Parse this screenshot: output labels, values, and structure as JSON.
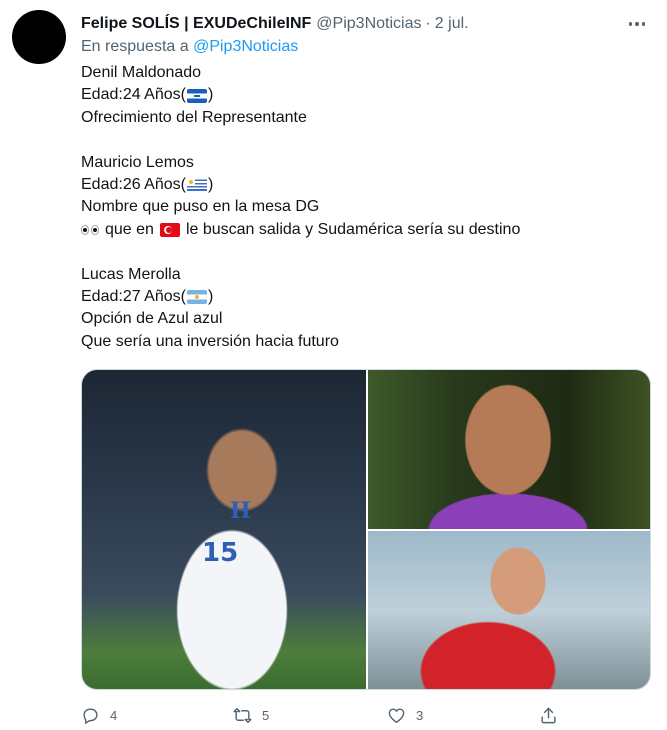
{
  "author": {
    "name": "Felipe SOLÍS | EXUDeChileINF",
    "handle": "@Pip3Noticias",
    "separator": "·",
    "date": "2 jul."
  },
  "reply_to": {
    "prefix": "En respuesta a",
    "mention": "@Pip3Noticias"
  },
  "body": {
    "p1": {
      "name": "Denil Maldonado",
      "age": "Edad:24 Años(",
      "age_close": ")",
      "flag": "honduras-flag",
      "note": "Ofrecimiento del Representante"
    },
    "p2": {
      "name": "Mauricio Lemos",
      "age": "Edad:26 Años(",
      "age_close": ")",
      "flag": "uruguay-flag",
      "note": "Nombre que puso en la mesa DG",
      "note2_a": "que en",
      "note2_flag": "turkey-flag",
      "note2_b": "le buscan salida y Sudamérica sería su destino"
    },
    "p3": {
      "name": "Lucas Merolla",
      "age": "Edad:27 Años(",
      "age_close": ")",
      "flag": "argentina-flag",
      "note": "Opción de Azul azul",
      "note2": "Que sería una inversión hacia futuro"
    }
  },
  "media": {
    "photo1": {
      "number": "15",
      "crest": "H"
    }
  },
  "actions": {
    "reply_count": "4",
    "retweet_count": "5",
    "like_count": "3"
  },
  "colors": {
    "text": "#0f1419",
    "secondary": "#536471",
    "link": "#1d9bf0",
    "border": "#cfd9de"
  }
}
